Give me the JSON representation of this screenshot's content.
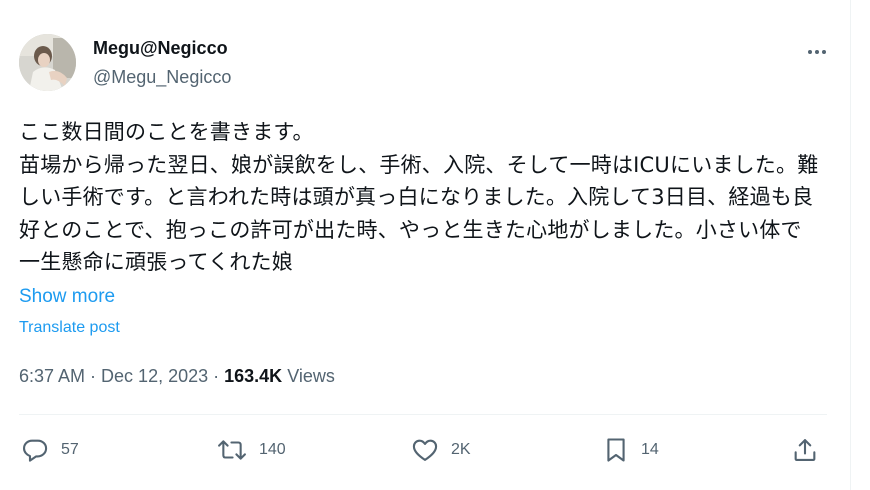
{
  "author": {
    "display_name": "Megu@Negicco",
    "handle": "@Megu_Negicco"
  },
  "post": {
    "text": "ここ数日間のことを書きます。\n苗場から帰った翌日、娘が誤飲をし、手術、入院、そして一時はICUにいました。難しい手術です。と言われた時は頭が真っ白になりました。入院して3日目、経過も良好とのことで、抱っこの許可が出た時、やっと生きた心地がしました。小さい体で一生懸命に頑張ってくれた娘",
    "show_more": "Show more",
    "translate": "Translate post",
    "time": "6:37 AM",
    "separator": " · ",
    "date": "Dec 12, 2023",
    "separator2": " · ",
    "views_count": "163.4K",
    "views_label": "Views"
  },
  "actions": {
    "reply_count": "57",
    "repost_count": "140",
    "like_count": "2K",
    "bookmark_count": "14"
  },
  "icons": {
    "more": "more-dots-icon",
    "reply": "reply-bubble-icon",
    "repost": "repost-arrows-icon",
    "like": "heart-icon",
    "bookmark": "bookmark-icon",
    "share": "share-upload-icon"
  },
  "colors": {
    "link": "#1d9bf0",
    "secondary_text": "#536471",
    "primary_text": "#0f1419",
    "divider": "#eff3f4"
  }
}
